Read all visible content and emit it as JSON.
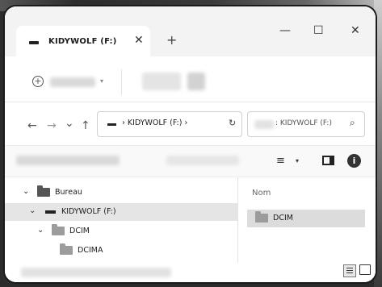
{
  "window": {
    "tab_title": "KIDYWOLF (F:)",
    "tab_close": "✕",
    "new_tab": "+",
    "minimize": "—",
    "maximize": "☐",
    "close": "✕"
  },
  "toolbar": {
    "new_icon": "+",
    "dropdown_caret": "▾"
  },
  "nav": {
    "back": "←",
    "forward": "→",
    "recent": "⌄",
    "up": "↑"
  },
  "address": {
    "separator": "›",
    "drive": "KIDYWOLF (F:)",
    "trailing_separator": "›",
    "refresh": "↻"
  },
  "search": {
    "placeholder": ": KIDYWOLF (F:)",
    "icon": "⌕"
  },
  "viewbar": {
    "sort_icon": "≡",
    "sort_caret": "▾",
    "info_icon": "i"
  },
  "tree": {
    "items": [
      {
        "label": "Bureau",
        "chevron": "⌄"
      },
      {
        "label": "KIDYWOLF (F:)",
        "chevron": "⌄"
      },
      {
        "label": "DCIM",
        "chevron": "⌄"
      },
      {
        "label": "DCIMA",
        "chevron": ""
      }
    ]
  },
  "content": {
    "column_header": "Nom",
    "files": [
      {
        "label": "DCIM"
      }
    ]
  },
  "colors": {
    "selection": "#e5e5e5",
    "file_selected": "#dcdcdc",
    "titlebar": "#f3f3f3"
  }
}
